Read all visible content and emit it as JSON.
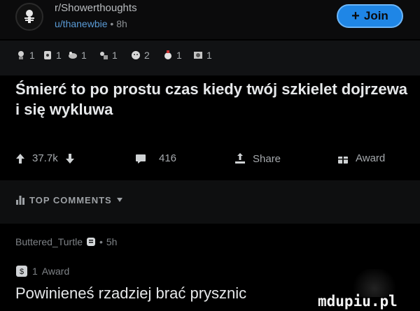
{
  "header": {
    "subreddit": "r/Showerthoughts",
    "username": "u/thanewbie",
    "separator": "•",
    "age": "8h",
    "join_label": "Join",
    "join_icon": "plus-icon"
  },
  "awards": [
    {
      "icon": "award-icon-1",
      "count": "1"
    },
    {
      "icon": "award-icon-2",
      "count": "1"
    },
    {
      "icon": "award-icon-3",
      "count": "1"
    },
    {
      "icon": "award-icon-4",
      "count": "1"
    },
    {
      "icon": "award-icon-5",
      "count": "2"
    },
    {
      "icon": "award-icon-6",
      "count": "1"
    },
    {
      "icon": "award-icon-7",
      "count": "1"
    }
  ],
  "post": {
    "title": "Śmierć to po prostu czas kiedy twój szkielet dojrzewa i się wykluwa"
  },
  "actions": {
    "votes": "37.7k",
    "comments": "416",
    "share_label": "Share",
    "award_label": "Award"
  },
  "top_comments": {
    "label": "TOP COMMENTS"
  },
  "comment": {
    "author": "Buttered_Turtle",
    "separator": "•",
    "age": "5h",
    "award_count": "1",
    "award_label": "Award",
    "text": "Powinieneś rzadziej brać prysznic"
  },
  "watermark": "mdupiu.pl",
  "colors": {
    "accent": "#1f86e6",
    "background": "#000000",
    "username": "#5a9bd6"
  }
}
